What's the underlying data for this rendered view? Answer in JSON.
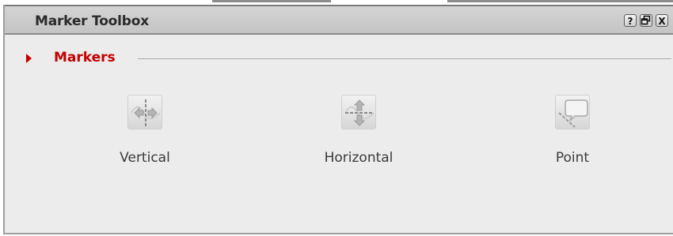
{
  "window": {
    "title": "Marker Toolbox",
    "help_label": "?",
    "restore_label": "❐",
    "close_label": "X"
  },
  "section": {
    "label": "Markers",
    "accent_color": "#c40000"
  },
  "tools": [
    {
      "label": "Vertical",
      "icon": "vertical-marker-icon"
    },
    {
      "label": "Horizontal",
      "icon": "horizontal-marker-icon"
    },
    {
      "label": "Point",
      "icon": "point-marker-icon"
    }
  ]
}
